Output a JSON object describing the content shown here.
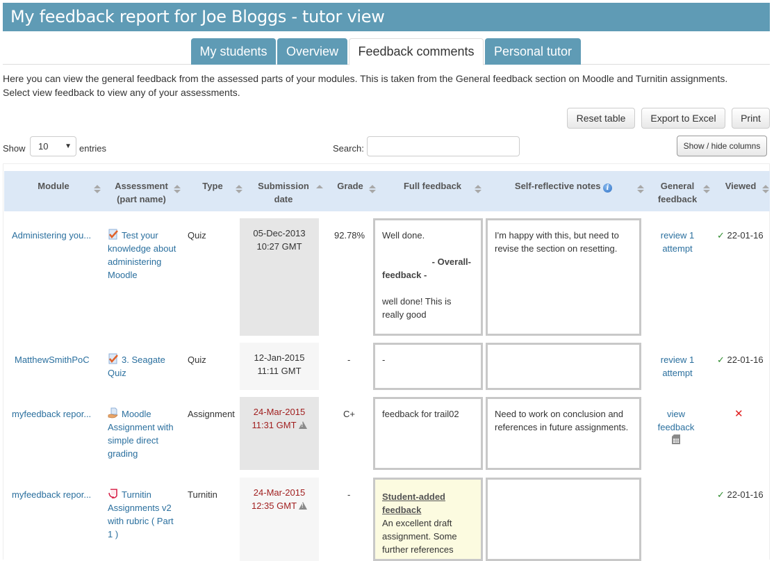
{
  "page": {
    "title": "My feedback report for Joe Bloggs - tutor view"
  },
  "tabs": [
    {
      "label": "My students",
      "active": false
    },
    {
      "label": "Overview",
      "active": false
    },
    {
      "label": "Feedback comments",
      "active": true
    },
    {
      "label": "Personal tutor",
      "active": false
    }
  ],
  "intro": {
    "line1": "Here you can view the general feedback from the assessed parts of your modules. This is taken from the General feedback section on Moodle and Turnitin assignments.",
    "line2": "Select view feedback to view any of your assessments."
  },
  "toolbar": {
    "reset_label": "Reset table",
    "export_label": "Export to Excel",
    "print_label": "Print",
    "show_hide_label": "Show / hide columns"
  },
  "controls": {
    "show_label": "Show",
    "entries_value": "10",
    "entries_label": "entries",
    "search_label": "Search:",
    "search_value": ""
  },
  "colors": {
    "brand": "#5f9bb5",
    "header_bg": "#dce8f6",
    "link": "#2a6f9e",
    "late": "#a11f1f",
    "viewed": "#2e8b2e",
    "not_viewed": "#e02020",
    "student_feedback_bg": "#fcfbe0"
  },
  "table": {
    "columns": [
      {
        "label": "Module",
        "sort": "both"
      },
      {
        "label": "Assessment (part name)",
        "sort": "both"
      },
      {
        "label": "Type",
        "sort": "both"
      },
      {
        "label": "Submission date",
        "sort": "asc"
      },
      {
        "label": "Grade",
        "sort": "both"
      },
      {
        "label": "Full feedback",
        "sort": "both"
      },
      {
        "label": "Self-reflective notes",
        "sort": "both",
        "icon": "info-icon"
      },
      {
        "label": "General feedback",
        "sort": "both"
      },
      {
        "label": "Viewed",
        "sort": "both"
      }
    ],
    "rows": [
      {
        "module": "Administering you...",
        "assessment_icon": "quiz-icon",
        "assessment": "Test your knowledge about administering Moodle",
        "type": "Quiz",
        "date": "05-Dec-2013",
        "time": "10:27 GMT",
        "late": false,
        "grade": "92.78%",
        "feedback_intro": "Well done.",
        "feedback_heading": "- Overall- feedback -",
        "feedback_body": "well done! This is really good",
        "notes": "I'm happy with this, but need to revise the section on resetting.",
        "general_feedback": "review 1 attempt",
        "viewed": true,
        "viewed_date": "22-01-16"
      },
      {
        "module": "MatthewSmithPoC",
        "assessment_icon": "quiz-icon",
        "assessment": "3. Seagate Quiz",
        "type": "Quiz",
        "date": "12-Jan-2015",
        "time": "11:11 GMT",
        "late": false,
        "grade": "-",
        "feedback_intro": "-",
        "notes": "",
        "general_feedback": "review 1 attempt",
        "viewed": true,
        "viewed_date": "22-01-16"
      },
      {
        "module": "myfeedback repor...",
        "assessment_icon": "assignment-icon",
        "assessment": "Moodle Assignment with simple direct grading",
        "type": "Assignment",
        "date": "24-Mar-2015",
        "time": "11:31 GMT",
        "late": true,
        "grade": "C+",
        "feedback_intro": "feedback for trail02",
        "notes": "Need to work on conclusion and references in future assignments.",
        "general_feedback": "view feedback",
        "general_feedback_icon": "document-icon",
        "viewed": false,
        "viewed_date": "",
        "viewed_symbol": "✕"
      },
      {
        "module": "myfeedback repor...",
        "assessment_icon": "turnitin-icon",
        "assessment": "Turnitin Assignments v2 with rubric ( Part 1 )",
        "type": "Turnitin",
        "date": "24-Mar-2015",
        "time": "12:35 GMT",
        "late": true,
        "grade": "-",
        "feedback_heading": "Student-added feedback",
        "feedback_body": "An excellent draft assignment. Some further references",
        "notes": "",
        "general_feedback": "",
        "viewed": true,
        "viewed_date": "22-01-16"
      }
    ],
    "check_symbol": "✓"
  }
}
